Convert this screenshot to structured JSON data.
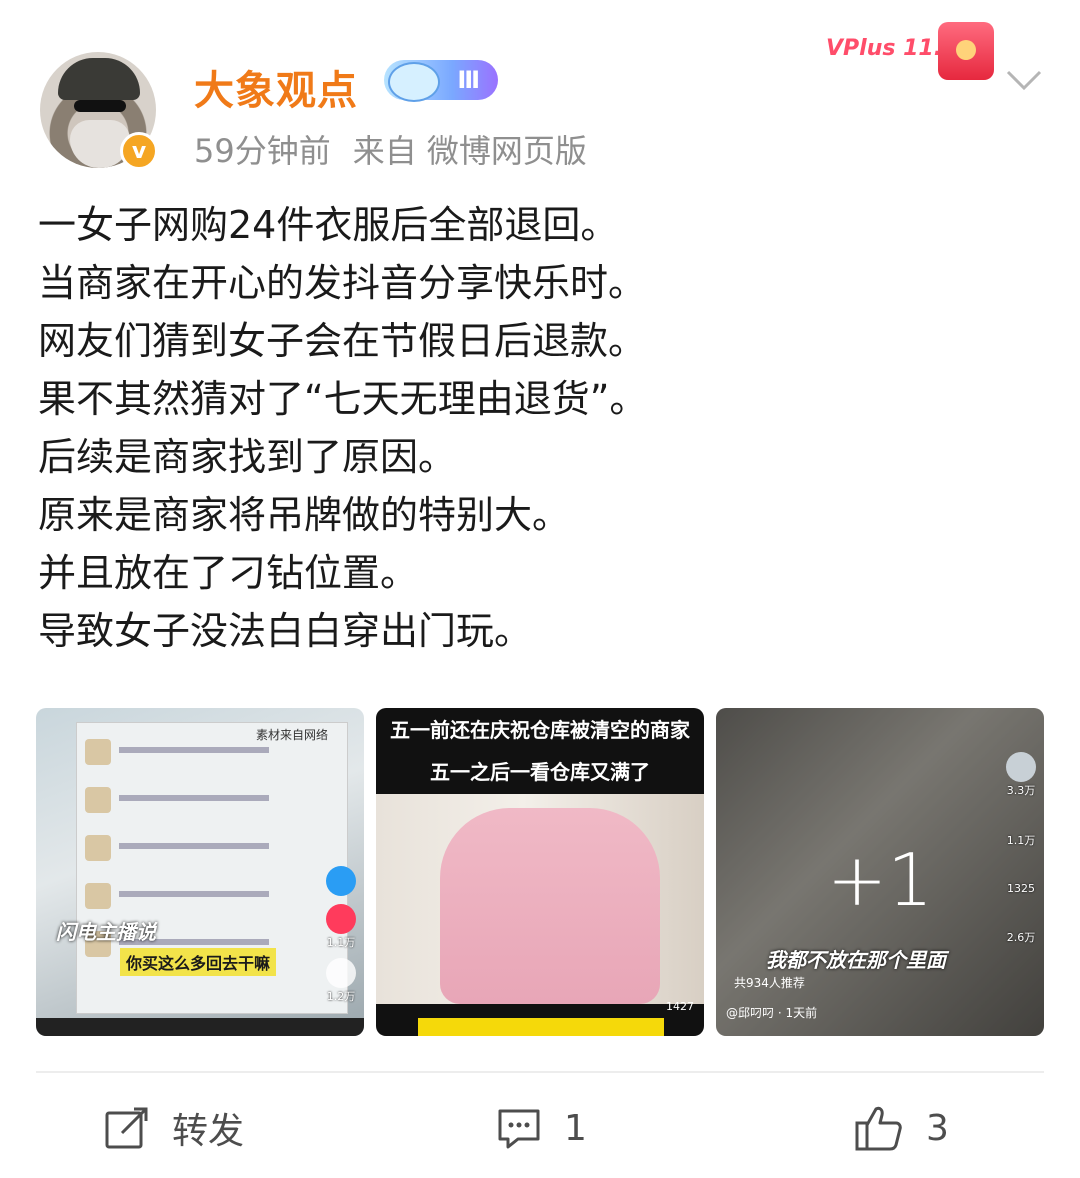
{
  "post": {
    "author": {
      "name": "大象观点",
      "verified_mark": "v",
      "level_label": "Ⅲ"
    },
    "meta": {
      "time": "59分钟前",
      "source": "来自 微博网页版"
    },
    "promo_label": "VPlus 11.11",
    "lines": [
      "一女子网购24件衣服后全部退回。",
      "当商家在开心的发抖音分享快乐时。",
      "网友们猜到女子会在节假日后退款。",
      "果不其然猜对了“七天无理由退货”。",
      "后续是商家找到了原因。",
      "原来是商家将吊牌做的特别大。",
      "并且放在了刁钻位置。",
      "导致女子没法白白穿出门玩。"
    ],
    "images": [
      {
        "watermark": "闪电主播说",
        "top_right": "素材来自网络",
        "caption": "你买这么多回去干嘛",
        "counts": [
          "1.1万",
          "1.2万"
        ]
      },
      {
        "caption_line1": "五一前还在庆祝仓库被清空的商家",
        "caption_line2": "五一之后一看仓库又满了",
        "count": "1427"
      },
      {
        "more": "+1",
        "caption": "我都不放在那个里面",
        "sub1": "共934人推荐",
        "sub2": "@邱叼叼 · 1天前",
        "counts": [
          "3.3万",
          "1.1万",
          "1325",
          "2.6万"
        ]
      }
    ]
  },
  "actions": {
    "share_label": "转发",
    "comment_count": "1",
    "like_count": "3"
  },
  "colors": {
    "username": "#f07a18",
    "meta": "#8f8f8f",
    "promo": "#ff4d6a"
  },
  "icons": {
    "share": "share-icon",
    "comment": "comment-icon",
    "like": "thumbs-up-icon",
    "more": "chevron-down-icon"
  }
}
